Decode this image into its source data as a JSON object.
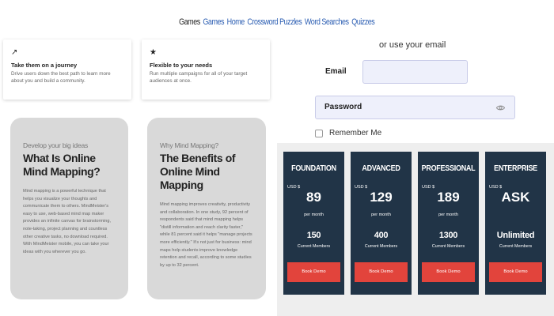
{
  "nav": {
    "brand": "Games",
    "links": [
      "Games",
      "Home",
      "Crossword Puzzles",
      "Word Searches",
      "Quizzes"
    ]
  },
  "features": [
    {
      "icon": "trend-arrow-icon",
      "glyph": "↗",
      "title": "Take them on a journey",
      "desc": "Drive users down the best path to learn more about you and build a community."
    },
    {
      "icon": "star-icon",
      "glyph": "★",
      "title": "Flexible to your needs",
      "desc": "Run multiple campaigns for all of your target audiences at once."
    }
  ],
  "articles": [
    {
      "subtitle": "Develop your big ideas",
      "title": "What Is Online Mind Mapping?",
      "body": "Mind mapping is a powerful technique that helps you visualize your thoughts and communicate them to others. MindMeister's easy to use, web-based mind map maker provides an infinite canvas for brainstorming, note-taking, project planning and countless other creative tasks, no download required. With MindMeister mobile, you can take your ideas with you wherever you go."
    },
    {
      "subtitle": "Why Mind Mapping?",
      "title": "The Benefits of Online Mind Mapping",
      "body": "Mind mapping improves creativity, productivity and collaboration. In one study, 92 percent of respondents said that mind mapping helps \"distill information and reach clarity faster,\" while 81 percent said it helps \"manage projects more efficiently.\" It's not just for business: mind maps help students improve knowledge retention and recall, according to some studies by up to 32 percent."
    }
  ],
  "login": {
    "or_email": "or use your email",
    "email_label": "Email",
    "email_value": "",
    "password_label": "Password",
    "remember_label": "Remember Me",
    "remember_checked": false
  },
  "pricing": {
    "colors": {
      "card": "#213447",
      "button": "#e2443c",
      "background": "#eeeeee"
    },
    "plans": [
      {
        "name": "FOUNDATION",
        "currency": "USD $",
        "price": "89",
        "period": "per month",
        "members": "150",
        "members_label": "Current Members",
        "button": "Book Demo"
      },
      {
        "name": "ADVANCED",
        "currency": "USD $",
        "price": "129",
        "period": "per month",
        "members": "400",
        "members_label": "Current Members",
        "button": "Book Demo"
      },
      {
        "name": "PROFESSIONAL",
        "currency": "USD $",
        "price": "189",
        "period": "per month",
        "members": "1300",
        "members_label": "Current Members",
        "button": "Book Demo"
      },
      {
        "name": "ENTERPRISE",
        "currency": "USD $",
        "price": "ASK",
        "period": "",
        "members": "Unlimited",
        "members_label": "Current Members",
        "button": "Book Demo"
      }
    ]
  }
}
